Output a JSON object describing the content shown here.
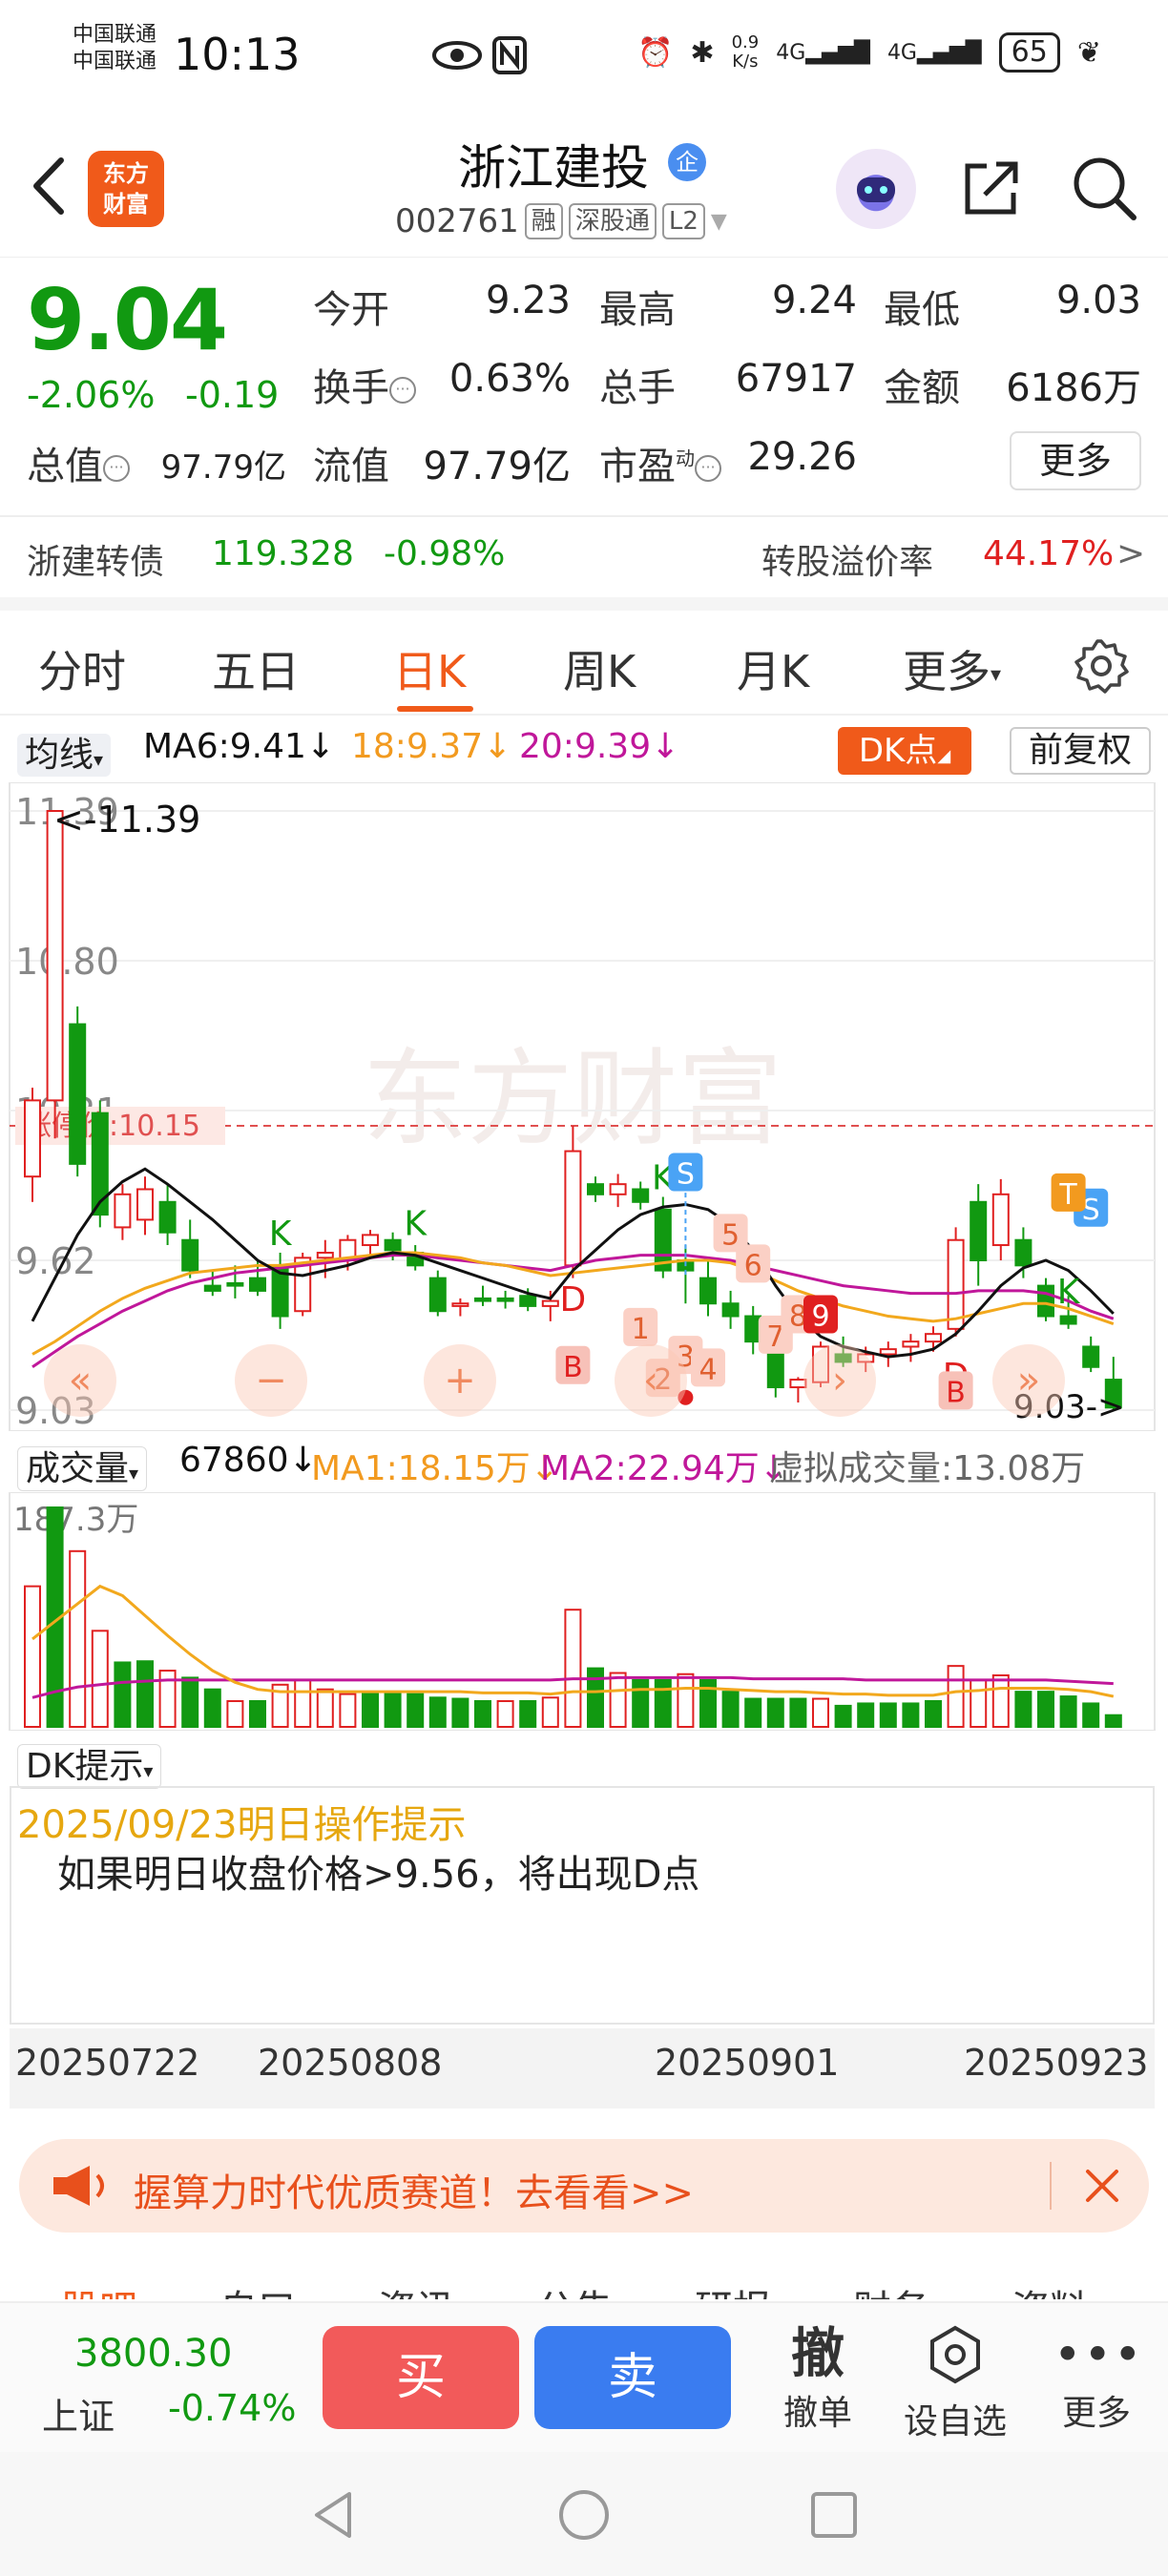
{
  "status_bar": {
    "carrier1": "中国联通",
    "carrier2": "中国联通",
    "time": "10:13",
    "net_speed_top": "0.9",
    "net_speed_bottom": "K/s",
    "net1": "4G",
    "net2": "4G",
    "battery": "65"
  },
  "header": {
    "brand_line1": "东方",
    "brand_line2": "财富",
    "stock_name": "浙江建投",
    "corp_badge": "企",
    "code": "002761",
    "tags": [
      "融",
      "深股通",
      "L2"
    ]
  },
  "quote": {
    "price": "9.04",
    "change_pct": "-2.06%",
    "change_abs": "-0.19",
    "fields": [
      {
        "label": "今开",
        "value": "9.23"
      },
      {
        "label": "最高",
        "value": "9.24"
      },
      {
        "label": "最低",
        "value": "9.03"
      },
      {
        "label": "换手",
        "value": "0.63%"
      },
      {
        "label": "总手",
        "value": "67917"
      },
      {
        "label": "金额",
        "value": "6186万"
      },
      {
        "label": "总值",
        "value": "97.79亿"
      },
      {
        "label": "流值",
        "value": "97.79亿"
      },
      {
        "label": "市盈",
        "value": "29.26"
      }
    ],
    "pe_superscript": "动",
    "more_label": "更多"
  },
  "convertible": {
    "name": "浙建转债",
    "price": "119.328",
    "change": "-0.98%",
    "premium_label": "转股溢价率",
    "premium_value": "44.17%",
    "arrow": ">"
  },
  "period_tabs": [
    "分时",
    "五日",
    "日K",
    "周K",
    "月K",
    "更多"
  ],
  "active_tab": "日K",
  "ma_row": {
    "selector": "均线",
    "ma6": "MA6:9.41",
    "ma18": "18:9.37",
    "ma20": "20:9.39",
    "dk_label": "DK点",
    "adjust_label": "前复权"
  },
  "colors": {
    "up": "#e02020",
    "down": "#119911",
    "ma6": "#111111",
    "ma18": "#f2a81d",
    "ma20": "#c0179a",
    "accent": "#f05a1a"
  },
  "chart_data": [
    {
      "type": "candlestick",
      "title": "",
      "y_tick_labels": [
        "11.39",
        "10.80",
        "10.21",
        "9.62",
        "9.03"
      ],
      "ylim": [
        9.03,
        11.39
      ],
      "high_marker": "<-11.39",
      "low_marker": "9.03->",
      "limit_up_label": "涨停价:10.15",
      "watermark": "东方财富",
      "x_labels": [
        "20250722",
        "20250808",
        "20250901",
        "20250923"
      ],
      "candles": [
        {
          "o": 9.95,
          "h": 10.3,
          "l": 9.85,
          "c": 10.25
        },
        {
          "o": 10.25,
          "h": 11.39,
          "l": 10.1,
          "c": 11.39
        },
        {
          "o": 10.55,
          "h": 10.62,
          "l": 9.95,
          "c": 10.0
        },
        {
          "o": 10.2,
          "h": 10.25,
          "l": 9.75,
          "c": 9.8
        },
        {
          "o": 9.75,
          "h": 9.92,
          "l": 9.7,
          "c": 9.88
        },
        {
          "o": 9.78,
          "h": 9.95,
          "l": 9.72,
          "c": 9.9
        },
        {
          "o": 9.85,
          "h": 9.92,
          "l": 9.68,
          "c": 9.73
        },
        {
          "o": 9.7,
          "h": 9.78,
          "l": 9.55,
          "c": 9.58
        },
        {
          "o": 9.52,
          "h": 9.58,
          "l": 9.48,
          "c": 9.5
        },
        {
          "o": 9.53,
          "h": 9.6,
          "l": 9.47,
          "c": 9.52
        },
        {
          "o": 9.55,
          "h": 9.62,
          "l": 9.48,
          "c": 9.5
        },
        {
          "o": 9.6,
          "h": 9.65,
          "l": 9.35,
          "c": 9.4
        },
        {
          "o": 9.42,
          "h": 9.65,
          "l": 9.4,
          "c": 9.63
        },
        {
          "o": 9.63,
          "h": 9.7,
          "l": 9.55,
          "c": 9.65
        },
        {
          "o": 9.62,
          "h": 9.72,
          "l": 9.58,
          "c": 9.7
        },
        {
          "o": 9.68,
          "h": 9.74,
          "l": 9.64,
          "c": 9.72
        },
        {
          "o": 9.7,
          "h": 9.73,
          "l": 9.62,
          "c": 9.66
        },
        {
          "o": 9.65,
          "h": 9.68,
          "l": 9.58,
          "c": 9.6
        },
        {
          "o": 9.55,
          "h": 9.58,
          "l": 9.4,
          "c": 9.42
        },
        {
          "o": 9.44,
          "h": 9.47,
          "l": 9.4,
          "c": 9.45
        },
        {
          "o": 9.47,
          "h": 9.52,
          "l": 9.44,
          "c": 9.46
        },
        {
          "o": 9.47,
          "h": 9.5,
          "l": 9.43,
          "c": 9.46
        },
        {
          "o": 9.48,
          "h": 9.51,
          "l": 9.42,
          "c": 9.44
        },
        {
          "o": 9.44,
          "h": 9.5,
          "l": 9.38,
          "c": 9.46
        },
        {
          "o": 9.6,
          "h": 10.15,
          "l": 9.55,
          "c": 10.05
        },
        {
          "o": 9.92,
          "h": 9.95,
          "l": 9.85,
          "c": 9.88
        },
        {
          "o": 9.88,
          "h": 9.96,
          "l": 9.83,
          "c": 9.92
        },
        {
          "o": 9.9,
          "h": 9.93,
          "l": 9.82,
          "c": 9.85
        },
        {
          "o": 9.82,
          "h": 9.87,
          "l": 9.55,
          "c": 9.58
        },
        {
          "o": 9.62,
          "h": 9.68,
          "l": 9.45,
          "c": 9.58
        },
        {
          "o": 9.55,
          "h": 9.62,
          "l": 9.4,
          "c": 9.45
        },
        {
          "o": 9.45,
          "h": 9.5,
          "l": 9.35,
          "c": 9.4
        },
        {
          "o": 9.4,
          "h": 9.44,
          "l": 9.25,
          "c": 9.3
        },
        {
          "o": 9.25,
          "h": 9.28,
          "l": 9.08,
          "c": 9.12
        },
        {
          "o": 9.12,
          "h": 9.16,
          "l": 9.06,
          "c": 9.15
        },
        {
          "o": 9.14,
          "h": 9.3,
          "l": 9.12,
          "c": 9.28
        },
        {
          "o": 9.25,
          "h": 9.32,
          "l": 9.2,
          "c": 9.22
        },
        {
          "o": 9.22,
          "h": 9.28,
          "l": 9.18,
          "c": 9.25
        },
        {
          "o": 9.25,
          "h": 9.3,
          "l": 9.2,
          "c": 9.27
        },
        {
          "o": 9.28,
          "h": 9.33,
          "l": 9.22,
          "c": 9.3
        },
        {
          "o": 9.3,
          "h": 9.36,
          "l": 9.26,
          "c": 9.33
        },
        {
          "o": 9.35,
          "h": 9.75,
          "l": 9.32,
          "c": 9.7
        },
        {
          "o": 9.85,
          "h": 9.92,
          "l": 9.52,
          "c": 9.62
        },
        {
          "o": 9.68,
          "h": 9.94,
          "l": 9.62,
          "c": 9.88
        },
        {
          "o": 9.7,
          "h": 9.75,
          "l": 9.55,
          "c": 9.6
        },
        {
          "o": 9.52,
          "h": 9.55,
          "l": 9.38,
          "c": 9.4
        },
        {
          "o": 9.4,
          "h": 9.48,
          "l": 9.35,
          "c": 9.37
        },
        {
          "o": 9.28,
          "h": 9.32,
          "l": 9.18,
          "c": 9.2
        },
        {
          "o": 9.15,
          "h": 9.24,
          "l": 9.03,
          "c": 9.04
        }
      ],
      "ma6": [
        9.38,
        9.55,
        9.72,
        9.85,
        9.93,
        9.98,
        9.92,
        9.85,
        9.78,
        9.7,
        9.62,
        9.57,
        9.56,
        9.58,
        9.6,
        9.63,
        9.65,
        9.64,
        9.61,
        9.58,
        9.55,
        9.52,
        9.49,
        9.47,
        9.58,
        9.66,
        9.74,
        9.8,
        9.83,
        9.84,
        9.82,
        9.76,
        9.66,
        9.52,
        9.4,
        9.32,
        9.28,
        9.26,
        9.24,
        9.25,
        9.27,
        9.33,
        9.42,
        9.52,
        9.59,
        9.62,
        9.58,
        9.5,
        9.41
      ],
      "ma18": [
        9.25,
        9.3,
        9.36,
        9.42,
        9.47,
        9.51,
        9.54,
        9.57,
        9.58,
        9.59,
        9.6,
        9.6,
        9.61,
        9.62,
        9.63,
        9.64,
        9.65,
        9.65,
        9.64,
        9.63,
        9.61,
        9.6,
        9.58,
        9.56,
        9.57,
        9.58,
        9.59,
        9.6,
        9.61,
        9.62,
        9.62,
        9.61,
        9.58,
        9.54,
        9.5,
        9.47,
        9.44,
        9.42,
        9.4,
        9.39,
        9.38,
        9.39,
        9.41,
        9.43,
        9.45,
        9.45,
        9.43,
        9.4,
        9.37
      ],
      "ma20": [
        9.2,
        9.26,
        9.32,
        9.37,
        9.42,
        9.46,
        9.5,
        9.53,
        9.55,
        9.57,
        9.58,
        9.59,
        9.6,
        9.61,
        9.62,
        9.63,
        9.64,
        9.64,
        9.63,
        9.62,
        9.61,
        9.6,
        9.59,
        9.58,
        9.6,
        9.62,
        9.63,
        9.64,
        9.64,
        9.64,
        9.63,
        9.62,
        9.6,
        9.58,
        9.56,
        9.54,
        9.52,
        9.51,
        9.5,
        9.49,
        9.49,
        9.49,
        9.5,
        9.5,
        9.5,
        9.49,
        9.46,
        9.42,
        9.39
      ]
    },
    {
      "type": "bar",
      "title": "",
      "y_top_label": "187.3万",
      "ymax": 187.3,
      "up_flags": [
        1,
        0,
        1,
        1,
        0,
        0,
        1,
        0,
        0,
        1,
        0,
        1,
        1,
        1,
        1,
        0,
        0,
        0,
        0,
        0,
        0,
        1,
        0,
        1,
        1,
        0,
        1,
        0,
        0,
        1,
        0,
        0,
        0,
        0,
        0,
        1,
        0,
        0,
        0,
        0,
        0,
        1,
        1,
        1,
        0,
        0,
        0,
        0,
        0
      ],
      "volumes": [
        120,
        187.3,
        150,
        82,
        55,
        56,
        48,
        42,
        32,
        22,
        22,
        36,
        40,
        32,
        28,
        30,
        30,
        28,
        25,
        24,
        22,
        22,
        22,
        25,
        100,
        50,
        46,
        40,
        40,
        45,
        40,
        30,
        24,
        24,
        24,
        24,
        18,
        20,
        20,
        20,
        22,
        52,
        40,
        44,
        30,
        30,
        26,
        20,
        10
      ],
      "ma1": [
        75,
        90,
        105,
        120,
        112,
        95,
        78,
        62,
        48,
        38,
        32,
        30,
        30,
        30,
        30,
        30,
        30,
        30,
        30,
        30,
        29,
        29,
        29,
        28,
        30,
        30,
        31,
        32,
        32,
        33,
        33,
        32,
        31,
        30,
        30,
        29,
        28,
        28,
        27,
        27,
        27,
        30,
        31,
        33,
        33,
        33,
        32,
        30,
        26
      ],
      "ma2": [
        25,
        30,
        34,
        36,
        38,
        39,
        40,
        40,
        40,
        40,
        40,
        40,
        40,
        40,
        40,
        40,
        40,
        40,
        40,
        40,
        40,
        40,
        40,
        40,
        41,
        41,
        42,
        42,
        42,
        42,
        42,
        42,
        41,
        41,
        41,
        41,
        41,
        40,
        40,
        40,
        40,
        40,
        40,
        40,
        40,
        40,
        39,
        38,
        37
      ]
    }
  ],
  "volume_row": {
    "selector": "成交量",
    "latest": "67860",
    "ma1": "MA1:18.15万",
    "ma2": "MA2:22.94万",
    "virtual": "虚拟成交量:13.08万"
  },
  "chart_controls": [
    "«",
    "−",
    "+",
    "‹",
    "›",
    "»"
  ],
  "dk_panel": {
    "selector": "DK提示",
    "title": "2025/09/23明日操作提示",
    "text": "如果明日收盘价格>9.56，将出现D点"
  },
  "markers": {
    "k": "K",
    "d": "D",
    "b": "B",
    "s": "S",
    "t": "T",
    "numbers": [
      "1",
      "2",
      "3",
      "4",
      "5",
      "6",
      "7",
      "8",
      "9"
    ]
  },
  "ad": {
    "text": "握算力时代优质赛道！去看看>>"
  },
  "section_tabs": [
    "股吧",
    "自口",
    "资讯",
    "公告",
    "研报",
    "财务",
    "资料"
  ],
  "bottom_bar": {
    "index_value": "3800.30",
    "index_name": "上证",
    "index_change": "-0.74%",
    "buy": "买",
    "sell": "卖",
    "cancel_icon_char": "撤",
    "cancel_label": "撤单",
    "watch_label": "设自选",
    "more_label": "更多"
  }
}
